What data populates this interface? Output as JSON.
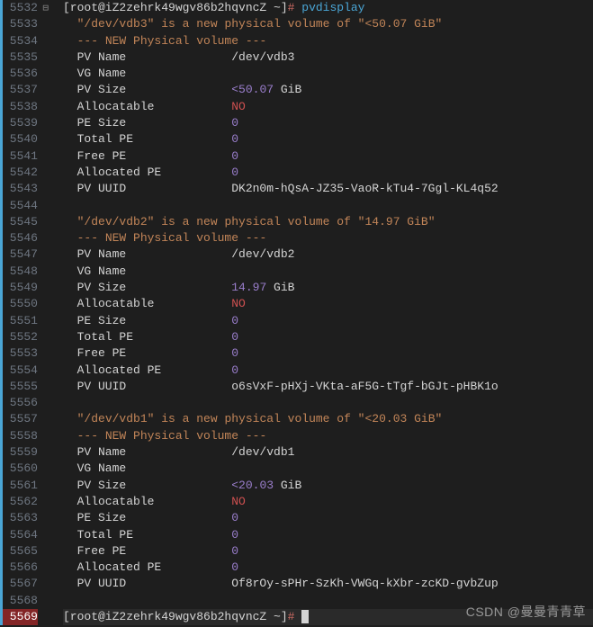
{
  "gutter": {
    "start": 5532,
    "end": 5569,
    "highlighted": 5569,
    "fold_at": 5532
  },
  "prompt": {
    "user_host": "[root@iZ2zehrk49wgv86b2hqvncZ ~]",
    "symbol": "#"
  },
  "command": "pvdisplay",
  "watermark": "CSDN @曼曼青青草",
  "volumes": [
    {
      "device": "/dev/vdb3",
      "intro_prefix": "\"",
      "intro_middle": "\" is a new physical volume of \"",
      "intro_suffix": "\"",
      "size_label": "<50.07 GiB",
      "header": "--- NEW Physical volume ---",
      "fields": {
        "pv_name": "/dev/vdb3",
        "vg_name": "",
        "pv_size_lt": "<",
        "pv_size_num": "50.07",
        "pv_size_unit": " GiB",
        "allocatable": "NO",
        "pe_size": "0",
        "total_pe": "0",
        "free_pe": "0",
        "allocated_pe": "0",
        "pv_uuid": "DK2n0m-hQsA-JZ35-VaoR-kTu4-7Ggl-KL4q52"
      }
    },
    {
      "device": "/dev/vdb2",
      "intro_prefix": "\"",
      "intro_middle": "\" is a new physical volume of \"",
      "intro_suffix": "\"",
      "size_label": "14.97 GiB",
      "header": "--- NEW Physical volume ---",
      "fields": {
        "pv_name": "/dev/vdb2",
        "vg_name": "",
        "pv_size_lt": "",
        "pv_size_num": "14.97",
        "pv_size_unit": " GiB",
        "allocatable": "NO",
        "pe_size": "0",
        "total_pe": "0",
        "free_pe": "0",
        "allocated_pe": "0",
        "pv_uuid": "o6sVxF-pHXj-VKta-aF5G-tTgf-bGJt-pHBK1o"
      }
    },
    {
      "device": "/dev/vdb1",
      "intro_prefix": "\"",
      "intro_middle": "\" is a new physical volume of \"",
      "intro_suffix": "\"",
      "size_label": "<20.03 GiB",
      "header": "--- NEW Physical volume ---",
      "fields": {
        "pv_name": "/dev/vdb1",
        "vg_name": "",
        "pv_size_lt": "<",
        "pv_size_num": "20.03",
        "pv_size_unit": " GiB",
        "allocatable": "NO",
        "pe_size": "0",
        "total_pe": "0",
        "free_pe": "0",
        "allocated_pe": "0",
        "pv_uuid": "Of8rOy-sPHr-SzKh-VWGq-kXbr-zcKD-gvbZup"
      }
    }
  ],
  "labels": {
    "pv_name": "PV Name",
    "vg_name": "VG Name",
    "pv_size": "PV Size",
    "allocatable": "Allocatable",
    "pe_size": "PE Size",
    "total_pe": "Total PE",
    "free_pe": "Free PE",
    "allocated_pe": "Allocated PE",
    "pv_uuid": "PV UUID"
  }
}
